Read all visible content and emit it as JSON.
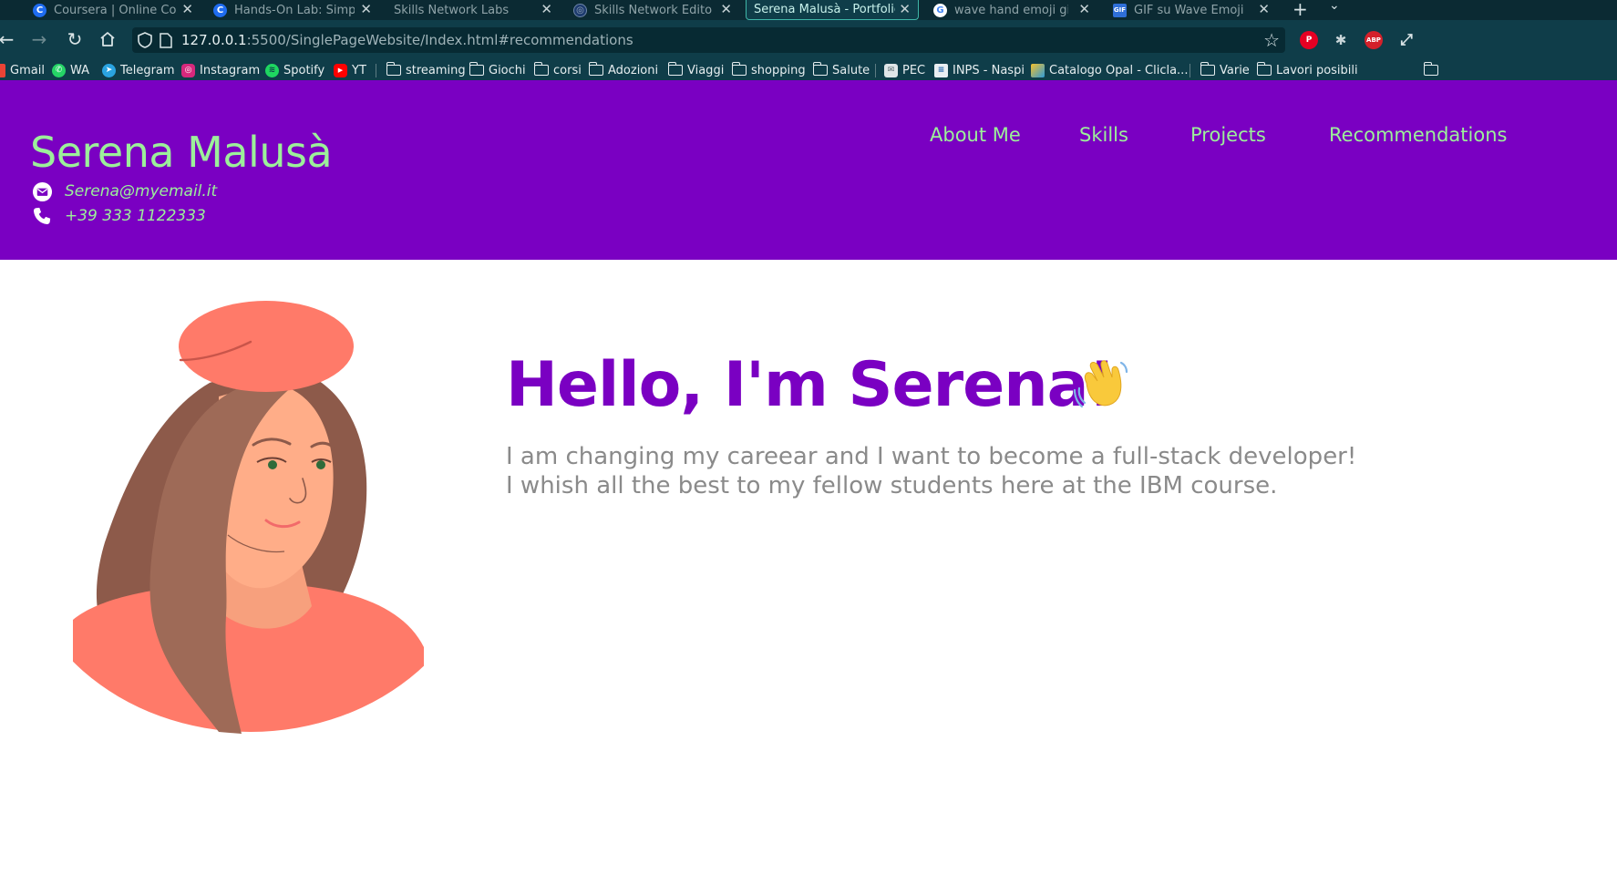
{
  "browser": {
    "tabs": [
      {
        "title": "Coursera | Online Cour",
        "icon": "coursera-icon",
        "active": false
      },
      {
        "title": "Hands-On Lab: Simple",
        "icon": "coursera-icon",
        "active": false
      },
      {
        "title": "Skills Network Labs",
        "icon": "none",
        "active": false
      },
      {
        "title": "Skills Network Editor",
        "icon": "skills-network-icon",
        "active": false
      },
      {
        "title": "Serena Malusà - Portfolio",
        "icon": "none",
        "active": true
      },
      {
        "title": "wave hand emoji gif -",
        "icon": "google-icon",
        "active": false
      },
      {
        "title": "GIF su Wave Emoji | Te",
        "icon": "gif-icon",
        "active": false
      }
    ],
    "gif_icon_text": "GIF",
    "url": {
      "host": "127.0.0.1",
      "path": ":5500/SinglePageWebsite/Index.html#recommendations"
    },
    "extensions": {
      "abp_label": "ABP"
    },
    "bookmarks": [
      {
        "label": "Gmail",
        "icon": "gmail-icon"
      },
      {
        "label": "WA",
        "icon": "whatsapp-icon"
      },
      {
        "label": "Telegram",
        "icon": "telegram-icon"
      },
      {
        "label": "Instagram",
        "icon": "instagram-icon"
      },
      {
        "label": "Spotify",
        "icon": "spotify-icon"
      },
      {
        "label": "YT",
        "icon": "youtube-icon"
      },
      {
        "label": "streaming",
        "icon": "folder-icon"
      },
      {
        "label": "Giochi",
        "icon": "folder-icon"
      },
      {
        "label": "corsi",
        "icon": "folder-icon"
      },
      {
        "label": "Adozioni",
        "icon": "folder-icon"
      },
      {
        "label": "Viaggi",
        "icon": "folder-icon"
      },
      {
        "label": "shopping",
        "icon": "folder-icon"
      },
      {
        "label": "Salute",
        "icon": "folder-icon"
      },
      {
        "label": "PEC",
        "icon": "pec-icon"
      },
      {
        "label": "INPS - Naspi",
        "icon": "inps-icon"
      },
      {
        "label": "Catalogo Opal - Clicla...",
        "icon": "opal-icon"
      },
      {
        "label": "Varie",
        "icon": "folder-icon"
      },
      {
        "label": "Lavori posibili",
        "icon": "folder-icon"
      }
    ]
  },
  "header": {
    "name": "Serena Malusà",
    "email": "Serena@myemail.it",
    "phone": "+39 333 1122333",
    "nav": [
      "About Me",
      "Skills",
      "Projects",
      "Recommendations"
    ]
  },
  "hero": {
    "title": "Hello, I'm Serena!",
    "line1": "I am changing my careear and I want to become a full-stack developer!",
    "line2": "I whish all the best to my fellow students here at the IBM course."
  },
  "colors": {
    "header_bg": "#7a00c2",
    "accent_green": "#9cf09a",
    "title_purple": "#7a00c2",
    "text_gray": "#8a8a8a",
    "chrome_bg": "#0f3d49"
  }
}
